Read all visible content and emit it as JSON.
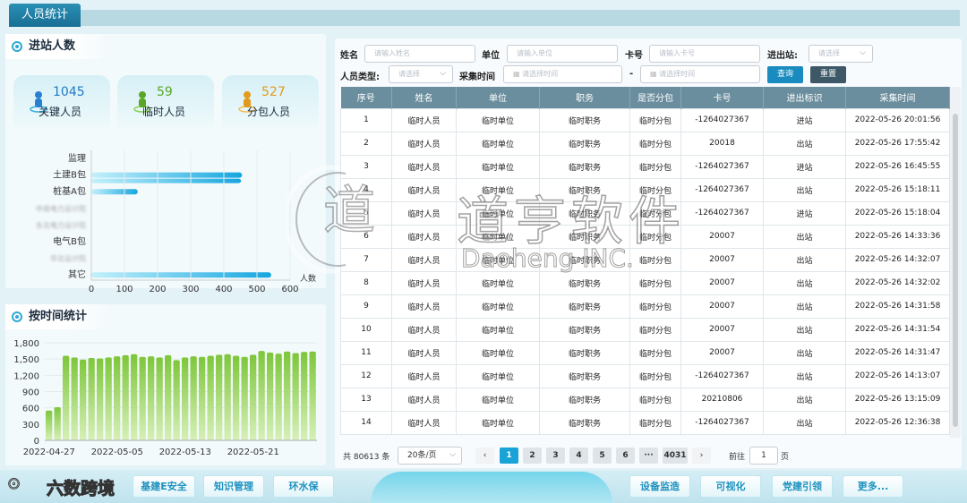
{
  "tab": {
    "title": "人员统计"
  },
  "station": {
    "title": "进站人数",
    "cards": [
      {
        "value": "1045",
        "label": "关键人员",
        "color": "#1f7ac7"
      },
      {
        "value": "59",
        "label": "临时人员",
        "color": "#5aa629"
      },
      {
        "value": "527",
        "label": "分包人员",
        "color": "#e39a1b"
      }
    ],
    "bar_labels": [
      "监理",
      "土建B包",
      "桩基A包",
      "中南电力设计院",
      "东北电力设计院",
      "电气B包",
      "华北设计院",
      "其它"
    ],
    "bar_values": [
      0,
      455,
      140,
      0,
      0,
      0,
      0,
      543
    ],
    "xticks": [
      "0",
      "100",
      "200",
      "300",
      "400",
      "500",
      "600"
    ],
    "xunit": "人数"
  },
  "time": {
    "title": "按时间统计",
    "yticks": [
      "1,800",
      "1,500",
      "1,200",
      "900",
      "600",
      "300",
      "0"
    ],
    "xticks": [
      "2022-04-27",
      "2022-05-05",
      "2022-05-13",
      "2022-05-21"
    ],
    "values": [
      550,
      610,
      1560,
      1530,
      1490,
      1520,
      1510,
      1530,
      1550,
      1570,
      1590,
      1540,
      1550,
      1530,
      1570,
      1480,
      1530,
      1550,
      1540,
      1560,
      1580,
      1590,
      1560,
      1540,
      1580,
      1650,
      1620,
      1600,
      1640,
      1610,
      1630,
      1640
    ]
  },
  "chart_data": [
    {
      "type": "bar",
      "title": "进站人数",
      "orientation": "horizontal",
      "categories": [
        "监理",
        "土建B包",
        "桩基A包",
        "中南电力设计院",
        "东北电力设计院",
        "电气B包",
        "华北设计院",
        "其它"
      ],
      "values": [
        0,
        455,
        140,
        0,
        0,
        0,
        0,
        543
      ],
      "xlabel": "人数",
      "xlim": [
        0,
        600
      ]
    },
    {
      "type": "bar",
      "title": "按时间统计",
      "x_start": "2022-04-27",
      "x_end": "2022-05-28",
      "categories": [
        "2022-04-27",
        "2022-04-28",
        "2022-04-29",
        "2022-04-30",
        "2022-05-01",
        "2022-05-02",
        "2022-05-03",
        "2022-05-04",
        "2022-05-05",
        "2022-05-06",
        "2022-05-07",
        "2022-05-08",
        "2022-05-09",
        "2022-05-10",
        "2022-05-11",
        "2022-05-12",
        "2022-05-13",
        "2022-05-14",
        "2022-05-15",
        "2022-05-16",
        "2022-05-17",
        "2022-05-18",
        "2022-05-19",
        "2022-05-20",
        "2022-05-21",
        "2022-05-22",
        "2022-05-23",
        "2022-05-24",
        "2022-05-25",
        "2022-05-26",
        "2022-05-27",
        "2022-05-28"
      ],
      "values": [
        550,
        610,
        1560,
        1530,
        1490,
        1520,
        1510,
        1530,
        1550,
        1570,
        1590,
        1540,
        1550,
        1530,
        1570,
        1480,
        1530,
        1550,
        1540,
        1560,
        1580,
        1590,
        1560,
        1540,
        1580,
        1650,
        1620,
        1600,
        1640,
        1610,
        1630,
        1640
      ],
      "ylim": [
        0,
        1800
      ]
    }
  ],
  "filters": {
    "name_label": "姓名",
    "name_ph": "请输入姓名",
    "unit_label": "单位",
    "unit_ph": "请输入单位",
    "card_label": "卡号",
    "card_ph": "请输入卡号",
    "inout_label": "进出站:",
    "inout_ph": "请选择",
    "type_label": "人员类型:",
    "type_ph": "请选择",
    "time_label": "采集时间",
    "date_ph1": "请选择时间",
    "dash": "-",
    "date_ph2": "请选择时间",
    "query": "查询",
    "reset": "重置"
  },
  "table": {
    "headers": [
      "序号",
      "姓名",
      "单位",
      "职务",
      "是否分包",
      "卡号",
      "进出标识",
      "采集时间"
    ],
    "rows": [
      [
        "1",
        "临时人员",
        "临时单位",
        "临时职务",
        "临时分包",
        "-1264027367",
        "进站",
        "2022-05-26 20:01:56"
      ],
      [
        "2",
        "临时人员",
        "临时单位",
        "临时职务",
        "临时分包",
        "20018",
        "出站",
        "2022-05-26 17:55:42"
      ],
      [
        "3",
        "临时人员",
        "临时单位",
        "临时职务",
        "临时分包",
        "-1264027367",
        "进站",
        "2022-05-26 16:45:55"
      ],
      [
        "4",
        "临时人员",
        "临时单位",
        "临时职务",
        "临时分包",
        "-1264027367",
        "出站",
        "2022-05-26 15:18:11"
      ],
      [
        "5",
        "临时人员",
        "临时单位",
        "临时职务",
        "临时分包",
        "-1264027367",
        "进站",
        "2022-05-26 15:18:04"
      ],
      [
        "6",
        "临时人员",
        "临时单位",
        "临时职务",
        "临时分包",
        "20007",
        "出站",
        "2022-05-26 14:33:36"
      ],
      [
        "7",
        "临时人员",
        "临时单位",
        "临时职务",
        "临时分包",
        "20007",
        "出站",
        "2022-05-26 14:32:07"
      ],
      [
        "8",
        "临时人员",
        "临时单位",
        "临时职务",
        "临时分包",
        "20007",
        "出站",
        "2022-05-26 14:32:02"
      ],
      [
        "9",
        "临时人员",
        "临时单位",
        "临时职务",
        "临时分包",
        "20007",
        "出站",
        "2022-05-26 14:31:58"
      ],
      [
        "10",
        "临时人员",
        "临时单位",
        "临时职务",
        "临时分包",
        "20007",
        "出站",
        "2022-05-26 14:31:54"
      ],
      [
        "11",
        "临时人员",
        "临时单位",
        "临时职务",
        "临时分包",
        "20007",
        "出站",
        "2022-05-26 14:31:47"
      ],
      [
        "12",
        "临时人员",
        "临时单位",
        "临时职务",
        "临时分包",
        "-1264027367",
        "出站",
        "2022-05-26 14:13:07"
      ],
      [
        "13",
        "临时人员",
        "临时单位",
        "临时职务",
        "临时分包",
        "20210806",
        "出站",
        "2022-05-26 13:15:09"
      ],
      [
        "14",
        "临时人员",
        "临时单位",
        "临时职务",
        "临时分包",
        "-1264027367",
        "出站",
        "2022-05-26 12:36:38"
      ]
    ]
  },
  "pagination": {
    "total": "共 80613 条",
    "per_page": "20条/页",
    "prev": "‹",
    "next": "›",
    "pages": [
      "1",
      "2",
      "3",
      "4",
      "5",
      "6",
      "···",
      "4031"
    ],
    "goto_label": "前往",
    "goto_value": "1",
    "page_suffix": "页"
  },
  "watermark": {
    "main": "道亨软件",
    "sub": "Daoheng INC."
  },
  "bottom": {
    "brand": "六数跨境",
    "left_nav": [
      "基建E安全",
      "知识管理",
      "环水保"
    ],
    "right_nav": [
      "设备监造",
      "可视化",
      "党建引领",
      "更多..."
    ]
  },
  "colors": {
    "accent": "#1aa3d6",
    "header": "#6b8e9e",
    "green": "#7ec63b"
  }
}
